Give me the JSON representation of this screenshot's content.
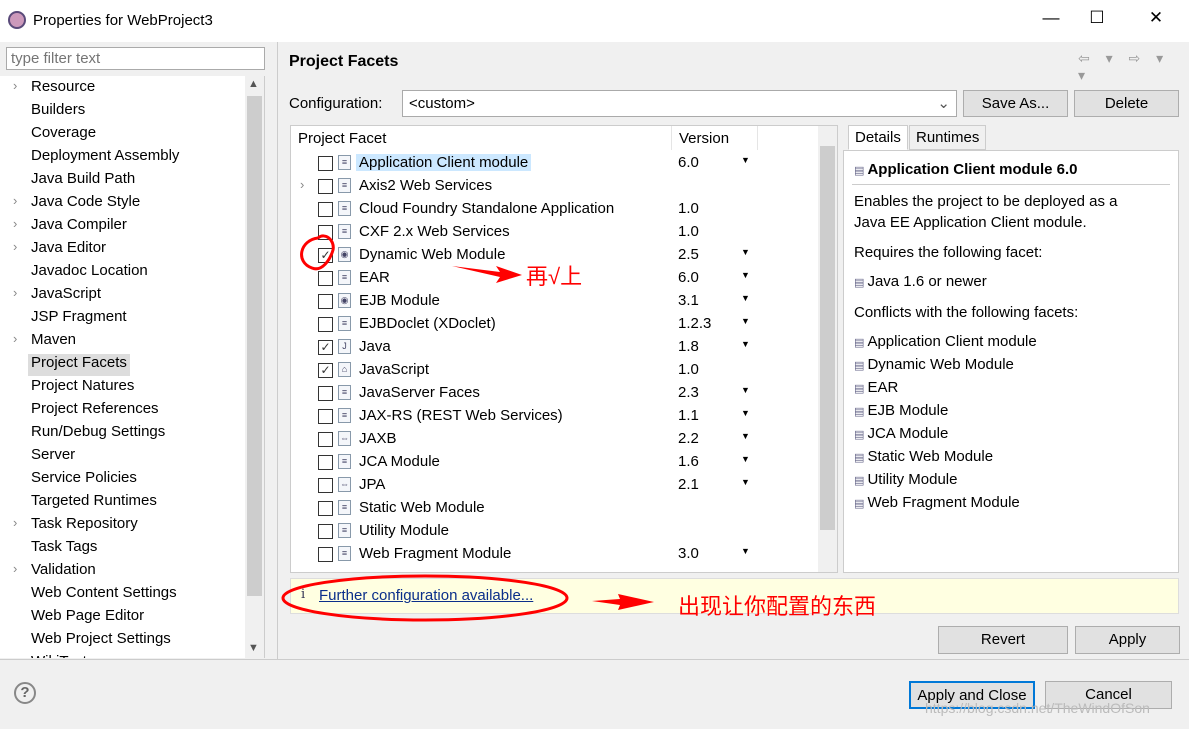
{
  "window": {
    "title": "Properties for WebProject3",
    "controls": [
      "—",
      "☐",
      "✕"
    ]
  },
  "filter": {
    "placeholder": "type filter text"
  },
  "tree": [
    {
      "label": "Resource",
      "expandable": true
    },
    {
      "label": "Builders"
    },
    {
      "label": "Coverage"
    },
    {
      "label": "Deployment Assembly"
    },
    {
      "label": "Java Build Path"
    },
    {
      "label": "Java Code Style",
      "expandable": true
    },
    {
      "label": "Java Compiler",
      "expandable": true
    },
    {
      "label": "Java Editor",
      "expandable": true
    },
    {
      "label": "Javadoc Location"
    },
    {
      "label": "JavaScript",
      "expandable": true
    },
    {
      "label": "JSP Fragment"
    },
    {
      "label": "Maven",
      "expandable": true
    },
    {
      "label": "Project Facets",
      "selected": true
    },
    {
      "label": "Project Natures"
    },
    {
      "label": "Project References"
    },
    {
      "label": "Run/Debug Settings"
    },
    {
      "label": "Server"
    },
    {
      "label": "Service Policies"
    },
    {
      "label": "Targeted Runtimes"
    },
    {
      "label": "Task Repository",
      "expandable": true
    },
    {
      "label": "Task Tags"
    },
    {
      "label": "Validation",
      "expandable": true
    },
    {
      "label": "Web Content Settings"
    },
    {
      "label": "Web Page Editor"
    },
    {
      "label": "Web Project Settings"
    },
    {
      "label": "WikiText"
    }
  ],
  "page": {
    "title": "Project Facets",
    "nav": "⇦ ▾ ⇨ ▾ ▾"
  },
  "config": {
    "label": "Configuration:",
    "value": "<custom>",
    "save_as": "Save As...",
    "delete": "Delete"
  },
  "table": {
    "headers": [
      "Project Facet",
      "Version"
    ],
    "rows": [
      {
        "name": "Application Client module",
        "version": "6.0",
        "dd": true,
        "checked": false,
        "highlight": true
      },
      {
        "name": "Axis2 Web Services",
        "version": "",
        "checked": false,
        "expandable": true
      },
      {
        "name": "Cloud Foundry Standalone Application",
        "version": "1.0",
        "checked": false
      },
      {
        "name": "CXF 2.x Web Services",
        "version": "1.0",
        "checked": false
      },
      {
        "name": "Dynamic Web Module",
        "version": "2.5",
        "dd": true,
        "checked": true
      },
      {
        "name": "EAR",
        "version": "6.0",
        "dd": true,
        "checked": false
      },
      {
        "name": "EJB Module",
        "version": "3.1",
        "dd": true,
        "checked": false
      },
      {
        "name": "EJBDoclet (XDoclet)",
        "version": "1.2.3",
        "dd": true,
        "checked": false
      },
      {
        "name": "Java",
        "version": "1.8",
        "dd": true,
        "checked": true
      },
      {
        "name": "JavaScript",
        "version": "1.0",
        "checked": true
      },
      {
        "name": "JavaServer Faces",
        "version": "2.3",
        "dd": true,
        "checked": false
      },
      {
        "name": "JAX-RS (REST Web Services)",
        "version": "1.1",
        "dd": true,
        "checked": false
      },
      {
        "name": "JAXB",
        "version": "2.2",
        "dd": true,
        "checked": false
      },
      {
        "name": "JCA Module",
        "version": "1.6",
        "dd": true,
        "checked": false
      },
      {
        "name": "JPA",
        "version": "2.1",
        "dd": true,
        "checked": false
      },
      {
        "name": "Static Web Module",
        "version": "",
        "checked": false
      },
      {
        "name": "Utility Module",
        "version": "",
        "checked": false
      },
      {
        "name": "Web Fragment Module",
        "version": "3.0",
        "dd": true,
        "checked": false
      }
    ]
  },
  "details": {
    "tabs": [
      "Details",
      "Runtimes"
    ],
    "title": "Application Client module 6.0",
    "desc1": "Enables the project to be deployed as a",
    "desc2": "Java EE Application Client module.",
    "requires_label": "Requires the following facet:",
    "requires": [
      "Java 1.6 or newer"
    ],
    "conflicts_label": "Conflicts with the following facets:",
    "conflicts": [
      "Application Client module",
      "Dynamic Web Module",
      "EAR",
      "EJB Module",
      "JCA Module",
      "Static Web Module",
      "Utility Module",
      "Web Fragment Module"
    ]
  },
  "info": {
    "icon": "i",
    "link": "Further configuration available..."
  },
  "buttons": {
    "revert": "Revert",
    "apply": "Apply",
    "apply_close": "Apply and Close",
    "cancel": "Cancel",
    "help": "?"
  },
  "annotations": {
    "check_note": "再√上",
    "config_note": "出现让你配置的东西",
    "accent": "#ff0000"
  },
  "watermark": "https://blog.csdn.net/TheWindOfSon"
}
